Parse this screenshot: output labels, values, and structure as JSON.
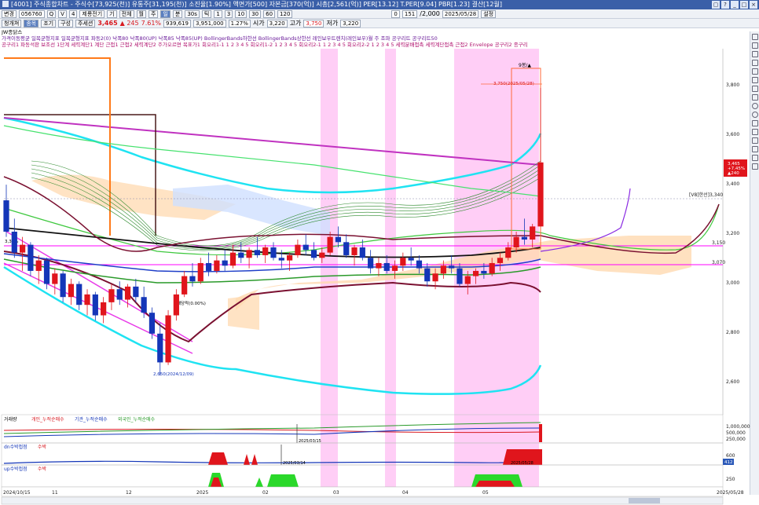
{
  "window": {
    "title": "[4001] 주식종합차트 - 주식수[73,925(천)] 유통주[31,195(천)] 소진율[1.90%] 액면가[500] 자본금[370(억)] 시총[2,561(억)] PER[13.12] T.PER[9.04] PBR[1.23] 결산[12월]",
    "buttons": [
      "▢",
      "?",
      "_",
      "□",
      "×"
    ]
  },
  "toolbar1": {
    "combo1": "변경",
    "code": "056760",
    "icons": [
      "Q",
      "V",
      "4"
    ],
    "name": "제룡전기",
    "period_buttons": [
      "월",
      "주",
      "일",
      "분",
      "30s",
      "틱"
    ],
    "mode_buttons": [
      "1",
      "3",
      "10",
      "30",
      "60",
      "120"
    ],
    "right_fields": [
      "0",
      "151",
      "/2,000"
    ],
    "date": "2025/05/28",
    "setting": "설정",
    "extra": [
      "기",
      "전체"
    ]
  },
  "toolbar2": {
    "tabs": [
      "청개쳐",
      "종목",
      "조기",
      "구성",
      "주세션"
    ],
    "price": "3,465",
    "change": "▲ 245",
    "rate": "7.61%",
    "volume": "939,619",
    "amount": "3,951,000",
    "ratio": "1.27%",
    "open_label": "시가",
    "open": "3,220",
    "high_label": "고가",
    "high": "3,750",
    "low_label": "저가",
    "low": "3,220"
  },
  "legend_rows": [
    "JW종닭스",
    "가격이동평균  일목균형지표  일목균형지표  파동2(0)  낙폭80  낙폭80(UP)  낙폭85  낙폭85(UP)  BollingerBands하한선  BollingerBands상한선  레인보우트렌치(레인보우)월 주 조파  공구리트  공구리트50",
    "공구리1  파동석판 보조선 1단계  세력계단1 계단 근접1 근접2 세력계단2 주가오르면  목표가1  회오리1-1 1 2 3 4 5  회오리1-2 1 2 3 4 5  회오리2-1 1 2 3 4 5  회오리2-2 1 2 3 4 5  세력분배접촉  세력계단접촉 근접2  Envelope  공구리2  종구리"
  ],
  "price_axis": {
    "labels": [
      "3,800",
      "3,600",
      "3,400",
      "3,200",
      "3,000",
      "2,800",
      "2,600"
    ],
    "current_price": "3,465",
    "current_change": "+7.45%",
    "current_volume": "▲240",
    "level1_label": "[V8]한선]3,340",
    "level2_label": "3,150",
    "level3_label": "3,070"
  },
  "chart_annotations": {
    "top_marker": "9봉/▲",
    "high_label": "3,750(2025/05/28)",
    "low_label": "2,650(2024/12/09)",
    "dividend_label": "배당락(0.00%)",
    "left_label": "3,38%"
  },
  "volume_panel": {
    "legend": [
      "거래량",
      "개인_누적순매수",
      "기관_누적순매수",
      "외국인_누적순매수"
    ],
    "axis": [
      "1,000,000",
      "500,000",
      "250,000"
    ],
    "marker": "2025/03/15"
  },
  "osc_panel1": {
    "legend": [
      "dn수박접점",
      "수박"
    ],
    "axis": [
      "600",
      "412"
    ],
    "marker": "2025/03/14",
    "right_marker": "2025/05/28"
  },
  "osc_panel2": {
    "legend": [
      "up수박접점",
      "수박"
    ],
    "axis": [
      "250"
    ]
  },
  "x_axis": {
    "labels": [
      "2024/10/15",
      "11",
      "12",
      "2025",
      "02",
      "03",
      "04",
      "05"
    ],
    "end_label": "2025/05/28"
  },
  "chart_data": {
    "type": "candlestick",
    "ylim": [
      2500,
      3900
    ],
    "candles": [
      [
        3320,
        3380,
        3180,
        3200
      ],
      [
        3200,
        3250,
        3100,
        3120
      ],
      [
        3120,
        3180,
        3050,
        3150
      ],
      [
        3150,
        3160,
        3030,
        3050
      ],
      [
        3050,
        3110,
        3000,
        3090
      ],
      [
        3090,
        3100,
        2980,
        3000
      ],
      [
        3000,
        3060,
        2960,
        3040
      ],
      [
        3040,
        3050,
        2930,
        2950
      ],
      [
        2950,
        3020,
        2920,
        3000
      ],
      [
        3000,
        3010,
        2900,
        2920
      ],
      [
        2920,
        2980,
        2880,
        2960
      ],
      [
        2960,
        2970,
        2860,
        2880
      ],
      [
        2880,
        2950,
        2850,
        2930
      ],
      [
        2930,
        3000,
        2900,
        2980
      ],
      [
        2980,
        3010,
        2920,
        2940
      ],
      [
        2940,
        3000,
        2910,
        2990
      ],
      [
        2990,
        3020,
        2930,
        2950
      ],
      [
        2950,
        2990,
        2870,
        2890
      ],
      [
        2890,
        2910,
        2790,
        2810
      ],
      [
        2810,
        2850,
        2650,
        2700
      ],
      [
        2700,
        2900,
        2690,
        2880
      ],
      [
        2880,
        2980,
        2860,
        2960
      ],
      [
        2960,
        3050,
        2950,
        3030
      ],
      [
        3030,
        3080,
        2990,
        3010
      ],
      [
        3010,
        3100,
        3000,
        3080
      ],
      [
        3080,
        3120,
        3030,
        3050
      ],
      [
        3050,
        3110,
        3040,
        3090
      ],
      [
        3090,
        3130,
        3050,
        3070
      ],
      [
        3070,
        3150,
        3060,
        3120
      ],
      [
        3120,
        3160,
        3080,
        3100
      ],
      [
        3100,
        3140,
        3060,
        3130
      ],
      [
        3130,
        3180,
        3100,
        3110
      ],
      [
        3110,
        3150,
        3080,
        3140
      ],
      [
        3140,
        3160,
        3090,
        3100
      ],
      [
        3100,
        3130,
        3060,
        3090
      ],
      [
        3090,
        3120,
        3050,
        3110
      ],
      [
        3110,
        3170,
        3100,
        3150
      ],
      [
        3150,
        3190,
        3110,
        3130
      ],
      [
        3130,
        3160,
        3090,
        3100
      ],
      [
        3100,
        3140,
        3080,
        3120
      ],
      [
        3120,
        3200,
        3110,
        3180
      ],
      [
        3180,
        3220,
        3140,
        3160
      ],
      [
        3160,
        3190,
        3100,
        3110
      ],
      [
        3110,
        3150,
        3070,
        3140
      ],
      [
        3140,
        3170,
        3090,
        3100
      ],
      [
        3100,
        3130,
        3040,
        3060
      ],
      [
        3060,
        3100,
        3030,
        3080
      ],
      [
        3080,
        3110,
        3040,
        3050
      ],
      [
        3050,
        3090,
        3020,
        3070
      ],
      [
        3070,
        3120,
        3050,
        3100
      ],
      [
        3100,
        3140,
        3070,
        3090
      ],
      [
        3090,
        3110,
        3040,
        3060
      ],
      [
        3060,
        3080,
        2990,
        3010
      ],
      [
        3010,
        3060,
        2980,
        3040
      ],
      [
        3040,
        3090,
        3020,
        3070
      ],
      [
        3070,
        3110,
        3040,
        3060
      ],
      [
        3060,
        3080,
        2990,
        3000
      ],
      [
        3000,
        3050,
        2960,
        3030
      ],
      [
        3030,
        3060,
        3000,
        3050
      ],
      [
        3050,
        3080,
        3020,
        3040
      ],
      [
        3040,
        3100,
        3030,
        3080
      ],
      [
        3080,
        3120,
        3050,
        3100
      ],
      [
        3100,
        3160,
        3090,
        3140
      ],
      [
        3140,
        3200,
        3120,
        3180
      ],
      [
        3180,
        3250,
        3150,
        3170
      ],
      [
        3170,
        3230,
        3140,
        3220
      ],
      [
        3220,
        3750,
        3220,
        3465
      ]
    ]
  },
  "colors": {
    "up": "#e0151c",
    "down": "#1436b8",
    "ma1": "#000000",
    "ma2": "#7a1030",
    "bollinger": "#21e6f2",
    "ichimoku": "#2a9a2a",
    "cloud_orange": "#ffd6a8",
    "pink_band": "#ff9cf0",
    "magenta": "#c032c0",
    "fan": "#2b7a2b"
  }
}
